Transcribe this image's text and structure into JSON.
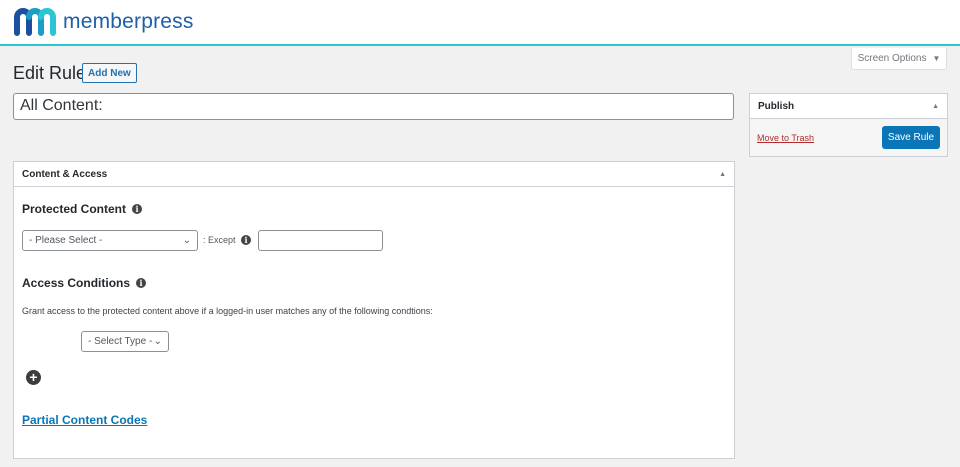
{
  "brand": {
    "name": "memberpress"
  },
  "screen_options": {
    "label": "Screen Options"
  },
  "page": {
    "title": "Edit Rule",
    "add_new": "Add New",
    "rule_title": "All Content:"
  },
  "publish": {
    "title": "Publish",
    "trash": "Move to Trash",
    "save": "Save Rule"
  },
  "content_access": {
    "title": "Content & Access",
    "protected_heading": "Protected Content",
    "protected_select": "- Please Select -",
    "except_label": ": Except",
    "except_value": "",
    "access_heading": "Access Conditions",
    "grant_text": "Grant access to the protected content above if a logged-in user matches any of the following condtions:",
    "type_select": "- Select Type -",
    "partial_link": "Partial Content Codes"
  },
  "colors": {
    "accent": "#0a76b8",
    "header_line": "#2ec5d3",
    "trash": "#b32d2e"
  }
}
